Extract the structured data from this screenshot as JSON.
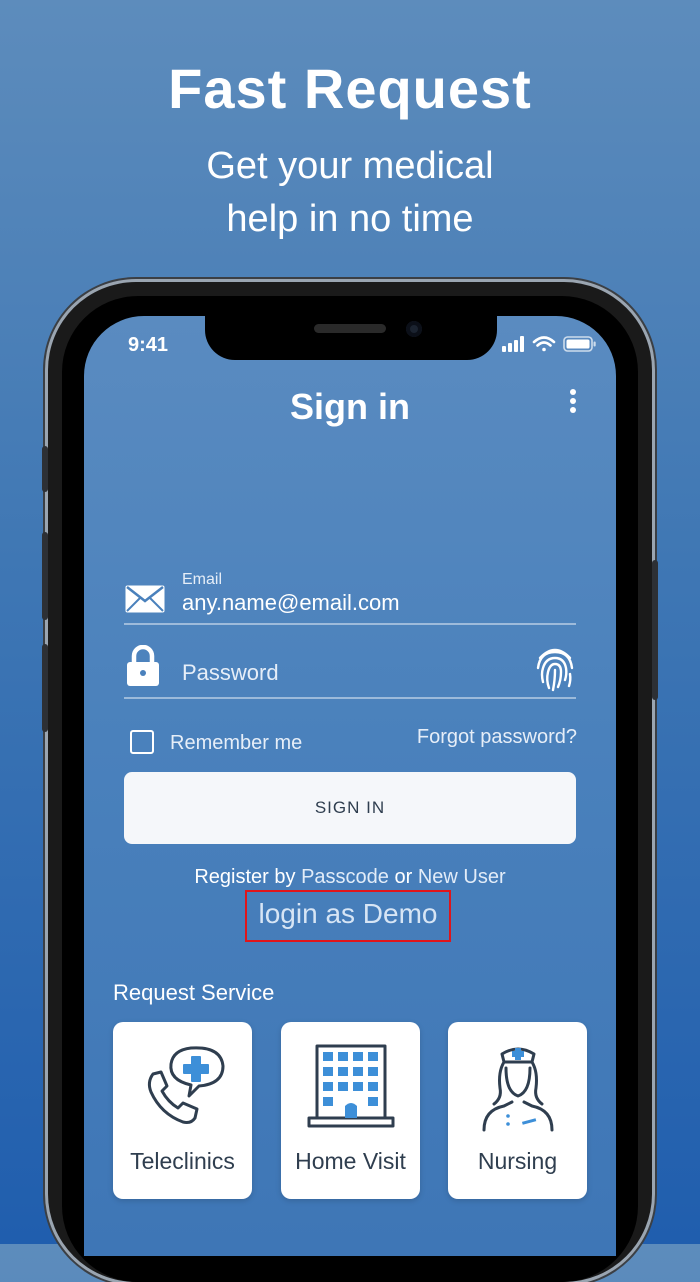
{
  "hero": {
    "title": "Fast Request",
    "subtitle_line1": "Get  your medical",
    "subtitle_line2": "help in no time"
  },
  "status_bar": {
    "time": "9:41"
  },
  "screen": {
    "title": "Sign in",
    "menu_icon": "kebab-menu-icon"
  },
  "form": {
    "email_label": "Email",
    "email_value": "any.name@email.com",
    "email_icon": "envelope-icon",
    "password_placeholder": "Password",
    "password_icon": "lock-icon",
    "fingerprint_icon": "fingerprint-icon",
    "remember_label": "Remember me",
    "remember_checked": false,
    "forgot_label": "Forgot password?",
    "signin_label": "SIGN IN"
  },
  "register": {
    "prefix": "Register by",
    "passcode": "Passcode",
    "or": "or",
    "new_user": "New User",
    "demo": "login as Demo"
  },
  "services": {
    "label": "Request Service",
    "items": [
      {
        "label": "Teleclinics",
        "icon": "phone-chat-cross-icon"
      },
      {
        "label": "Home Visit",
        "icon": "building-icon"
      },
      {
        "label": "Nursing",
        "icon": "nurse-icon"
      }
    ]
  },
  "colors": {
    "accent_blue": "#3d8fd8",
    "highlight_red": "#e0151b",
    "icon_dark": "#2f3e4f"
  }
}
